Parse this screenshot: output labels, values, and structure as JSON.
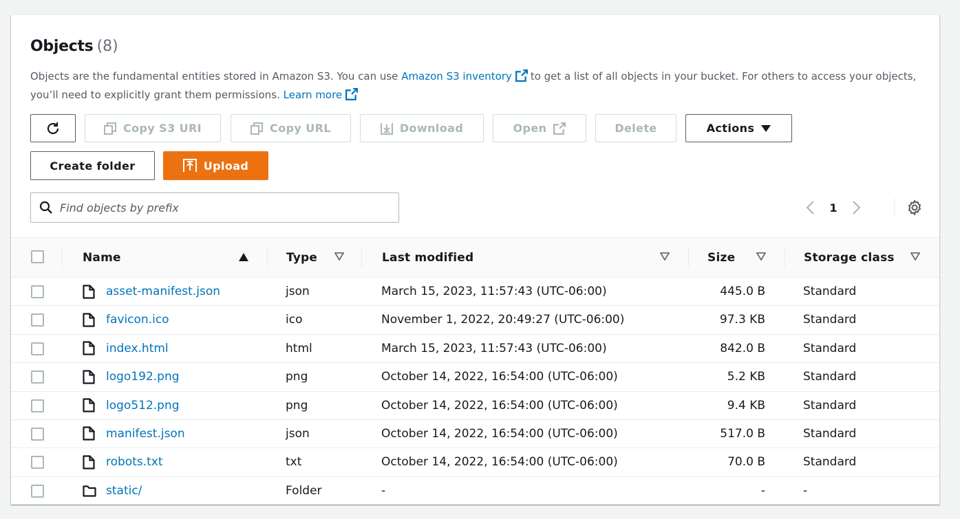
{
  "header": {
    "title": "Objects",
    "count": "(8)"
  },
  "description": {
    "part1": "Objects are the fundamental entities stored in Amazon S3. You can use ",
    "link1": "Amazon S3 inventory",
    "part2": "to get a list of all objects in your bucket. For others to access your objects, you’ll need to explicitly grant them permissions. ",
    "link2": "Learn more"
  },
  "toolbar": {
    "refresh_icon": "refresh-icon",
    "copy_s3_uri": "Copy S3 URI",
    "copy_url": "Copy URL",
    "download": "Download",
    "open": "Open",
    "delete": "Delete",
    "actions": "Actions",
    "create_folder": "Create folder",
    "upload": "Upload"
  },
  "search": {
    "placeholder": "Find objects by prefix",
    "value": ""
  },
  "pagination": {
    "current_page": "1"
  },
  "colors": {
    "link": "#0073bb",
    "primary": "#ec7211",
    "disabled": "#aab7b8"
  },
  "table": {
    "columns": {
      "name": "Name",
      "type": "Type",
      "last_modified": "Last modified",
      "size": "Size",
      "storage_class": "Storage class"
    },
    "rows": [
      {
        "name": "asset-manifest.json",
        "type": "json",
        "last_modified": "March 15, 2023, 11:57:43 (UTC-06:00)",
        "size": "445.0 B",
        "storage_class": "Standard",
        "icon": "file-icon"
      },
      {
        "name": "favicon.ico",
        "type": "ico",
        "last_modified": "November 1, 2022, 20:49:27 (UTC-06:00)",
        "size": "97.3 KB",
        "storage_class": "Standard",
        "icon": "file-icon"
      },
      {
        "name": "index.html",
        "type": "html",
        "last_modified": "March 15, 2023, 11:57:43 (UTC-06:00)",
        "size": "842.0 B",
        "storage_class": "Standard",
        "icon": "file-icon"
      },
      {
        "name": "logo192.png",
        "type": "png",
        "last_modified": "October 14, 2022, 16:54:00 (UTC-06:00)",
        "size": "5.2 KB",
        "storage_class": "Standard",
        "icon": "file-icon"
      },
      {
        "name": "logo512.png",
        "type": "png",
        "last_modified": "October 14, 2022, 16:54:00 (UTC-06:00)",
        "size": "9.4 KB",
        "storage_class": "Standard",
        "icon": "file-icon"
      },
      {
        "name": "manifest.json",
        "type": "json",
        "last_modified": "October 14, 2022, 16:54:00 (UTC-06:00)",
        "size": "517.0 B",
        "storage_class": "Standard",
        "icon": "file-icon"
      },
      {
        "name": "robots.txt",
        "type": "txt",
        "last_modified": "October 14, 2022, 16:54:00 (UTC-06:00)",
        "size": "70.0 B",
        "storage_class": "Standard",
        "icon": "file-icon"
      },
      {
        "name": "static/",
        "type": "Folder",
        "last_modified": "-",
        "size": "-",
        "storage_class": "-",
        "icon": "folder-icon"
      }
    ]
  }
}
